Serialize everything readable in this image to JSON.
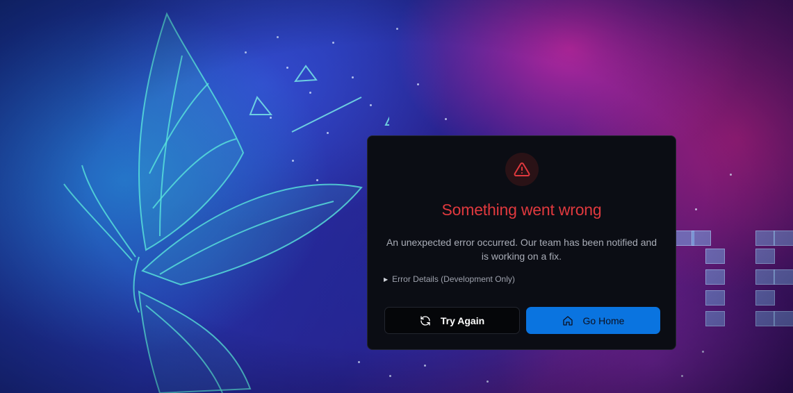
{
  "background": {
    "tile_letters": "E"
  },
  "error_dialog": {
    "icon": "warning-triangle-icon",
    "title": "Something went wrong",
    "message": "An unexpected error occurred. Our team has been notified and is working on a fix.",
    "details_toggle": {
      "icon": "triangle-right-icon",
      "label": "Error Details (Development Only)"
    },
    "buttons": {
      "try_again": {
        "label": "Try Again",
        "icon": "refresh-icon"
      },
      "go_home": {
        "label": "Go Home",
        "icon": "home-icon"
      }
    }
  },
  "colors": {
    "title": "#e0393e",
    "primary_button": "#0a74e0",
    "dialog_bg": "#0b0d14"
  }
}
